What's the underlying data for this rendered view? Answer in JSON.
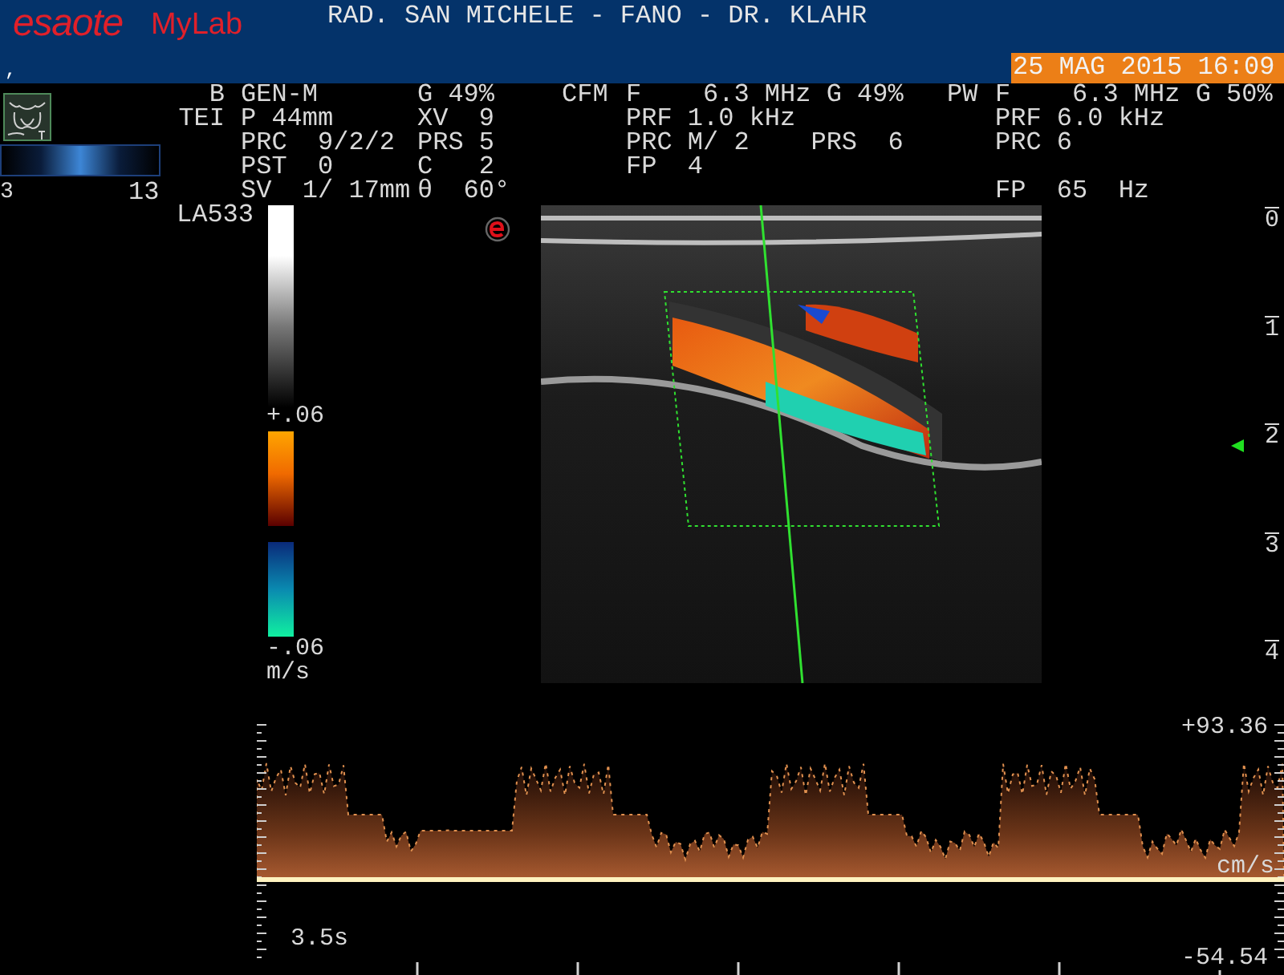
{
  "header": {
    "logo": "esaote",
    "product": "MyLab",
    "title": "RAD. SAN MICHELE - FANO - DR. KLAHR",
    "mark": ",",
    "datetime": "25 MAG 2015 16:09"
  },
  "b_mode": {
    "rows": [
      {
        "label": "B",
        "value": "GEN-M",
        "extra": "G 49%"
      },
      {
        "label": "TEI",
        "value": "P 44mm",
        "extra": "XV  9"
      },
      {
        "value": "PRC  9/2/2",
        "extra": "PRS 5"
      },
      {
        "value": "PST  0",
        "extra": "C   2"
      },
      {
        "value": "SV  1/ 17mm",
        "extra": "θ  60°"
      }
    ]
  },
  "cfm": {
    "label": "CFM",
    "rows": [
      "F    6.3 MHz G 49%",
      "PRF 1.0 kHz",
      "PRC M/ 2    PRS  6",
      "FP  4"
    ]
  },
  "pw": {
    "label": "PW",
    "rows": [
      "F    6.3 MHz G 50%",
      "PRF 6.0 kHz",
      "PRC 6"
    ],
    "fp": "FP  65  Hz"
  },
  "map_scale": {
    "min": "3",
    "max": "13"
  },
  "probe": "LA533",
  "color_scale": {
    "top": "+.06",
    "bottom": "-.06",
    "unit": "m/s"
  },
  "depth_scale": [
    "0",
    "1",
    "2",
    "3",
    "4"
  ],
  "spectrum": {
    "max": "+93.36",
    "unit": "cm/s",
    "min": "-54.54",
    "sweep": "3.5s"
  }
}
